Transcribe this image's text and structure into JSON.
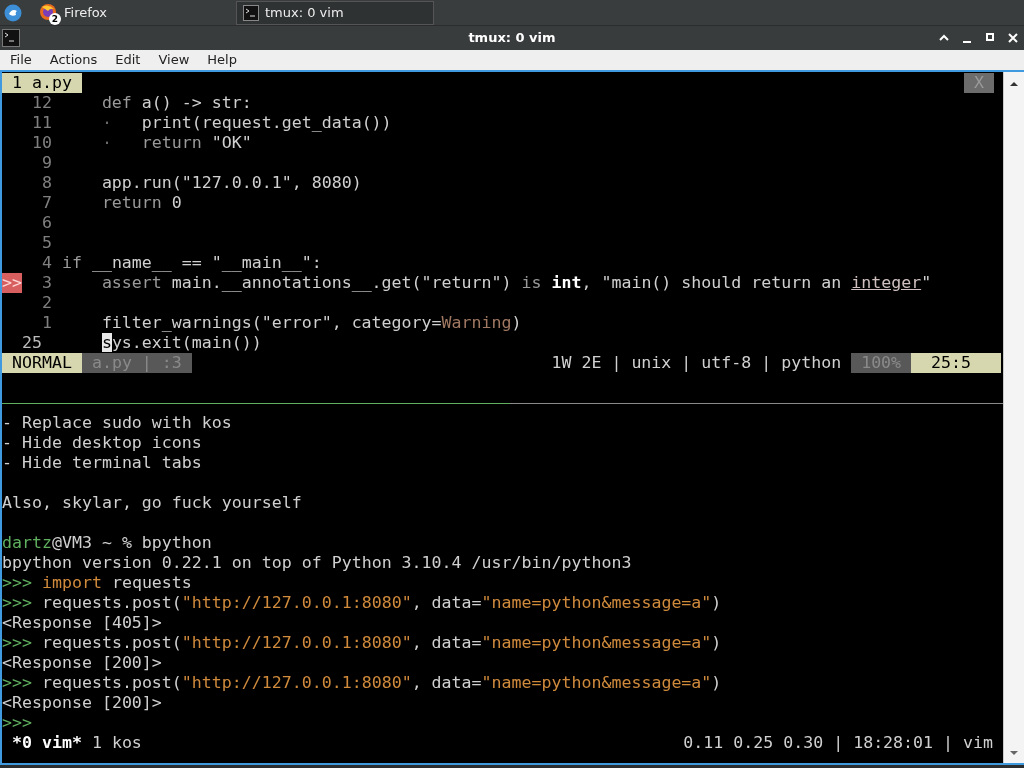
{
  "taskbar": {
    "tasks": [
      {
        "kind": "browser",
        "label": "Firefox",
        "badge": "2",
        "selected": false
      },
      {
        "kind": "terminal",
        "label": "tmux: 0 vim",
        "selected": true
      }
    ]
  },
  "window": {
    "title": "tmux: 0 vim"
  },
  "menu": [
    "File",
    "Actions",
    "Edit",
    "View",
    "Help"
  ],
  "vim": {
    "tab": "1 a.py",
    "close": "X",
    "lines": [
      {
        "number": "12",
        "current": false,
        "segments": [
          {
            "text": "    def",
            "kind": "keyword"
          },
          {
            "text": " a() -> str:",
            "kind": "normal"
          }
        ]
      },
      {
        "number": "11",
        "current": false,
        "segments": [
          {
            "text": "    ·",
            "kind": "dim"
          },
          {
            "text": "   print(request.get_data())",
            "kind": "normal"
          }
        ]
      },
      {
        "number": "10",
        "current": false,
        "segments": [
          {
            "text": "    ·",
            "kind": "dim"
          },
          {
            "text": "   return",
            "kind": "keyword"
          },
          {
            "text": " \"OK\"",
            "kind": "normal"
          }
        ]
      },
      {
        "number": "9",
        "current": false
      },
      {
        "number": "8",
        "current": false,
        "segments": [
          {
            "text": "    app.run(\"127.0.0.1\", 8080)",
            "kind": "normal"
          }
        ]
      },
      {
        "number": "7",
        "current": false,
        "segments": [
          {
            "text": "    return",
            "kind": "keyword"
          },
          {
            "text": " 0",
            "kind": "normal"
          }
        ]
      },
      {
        "number": "6",
        "current": false
      },
      {
        "number": "5",
        "current": false
      },
      {
        "number": "4",
        "current": false,
        "segments": [
          {
            "text": "if",
            "kind": "keyword"
          },
          {
            "text": " __name__ == \"__main__\":",
            "kind": "normal"
          }
        ]
      },
      {
        "number": "3",
        "current": false,
        "sign": ">>",
        "segments": [
          {
            "text": "    assert",
            "kind": "keyword"
          },
          {
            "text": " main.__annotations__.get(\"return\") ",
            "kind": "normal"
          },
          {
            "text": "is",
            "kind": "keyword"
          },
          {
            "text": " int",
            "kind": "bold"
          },
          {
            "text": ", \"main() should return an ",
            "kind": "normal"
          },
          {
            "text": "integer",
            "kind": "spell"
          },
          {
            "text": "\"",
            "kind": "normal"
          }
        ]
      },
      {
        "number": "2",
        "current": false
      },
      {
        "number": "1",
        "current": false,
        "segments": [
          {
            "text": "    filter_warnings(\"error\", category=",
            "kind": "normal"
          },
          {
            "text": "Warning",
            "kind": "builtin"
          },
          {
            "text": ")",
            "kind": "normal"
          }
        ]
      },
      {
        "number": "25",
        "current": true,
        "segments": [
          {
            "text": "    s",
            "kind": "cursor"
          },
          {
            "text": "ys.exit(main())",
            "kind": "normal"
          }
        ]
      }
    ],
    "statusline": {
      "mode": "NORMAL",
      "file": "a.py | :3",
      "info": "1W 2E | unix | utf-8 | python",
      "percent": "100%",
      "position": "25:5"
    }
  },
  "shell": {
    "blocks": [
      [
        [
          {
            "text": "- Replace sudo with kos",
            "kind": "normal"
          }
        ],
        [
          {
            "text": "- Hide desktop icons",
            "kind": "normal"
          }
        ],
        [
          {
            "text": "- Hide terminal tabs",
            "kind": "normal"
          }
        ]
      ],
      [
        [
          {
            "text": "Also, skylar, go fuck yourself",
            "kind": "normal"
          }
        ]
      ],
      [
        [
          {
            "text": "dartz",
            "kind": "green"
          },
          {
            "text": "@VM3 ~ % bpython",
            "kind": "normal"
          }
        ],
        [
          {
            "text": "bpython version 0.22.1 on top of Python 3.10.4 /usr/bin/python3",
            "kind": "normal"
          }
        ],
        [
          {
            "text": ">>>",
            "kind": "green"
          },
          {
            "text": " import",
            "kind": "orange"
          },
          {
            "text": " requests",
            "kind": "normal"
          }
        ],
        [
          {
            "text": ">>>",
            "kind": "green"
          },
          {
            "text": " requests.post(",
            "kind": "normal"
          },
          {
            "text": "\"http://127.0.0.1:8080\"",
            "kind": "orange"
          },
          {
            "text": ", data=",
            "kind": "normal"
          },
          {
            "text": "\"name=python&message=a\"",
            "kind": "orange"
          },
          {
            "text": ")",
            "kind": "normal"
          }
        ],
        [
          {
            "text": "<Response [405]>",
            "kind": "normal"
          }
        ],
        [
          {
            "text": ">>>",
            "kind": "green"
          },
          {
            "text": " requests.post(",
            "kind": "normal"
          },
          {
            "text": "\"http://127.0.0.1:8080\"",
            "kind": "orange"
          },
          {
            "text": ", data=",
            "kind": "normal"
          },
          {
            "text": "\"name=python&message=a\"",
            "kind": "orange"
          },
          {
            "text": ")",
            "kind": "normal"
          }
        ],
        [
          {
            "text": "<Response [200]>",
            "kind": "normal"
          }
        ],
        [
          {
            "text": ">>>",
            "kind": "green"
          },
          {
            "text": " requests.post(",
            "kind": "normal"
          },
          {
            "text": "\"http://127.0.0.1:8080\"",
            "kind": "orange"
          },
          {
            "text": ", data=",
            "kind": "normal"
          },
          {
            "text": "\"name=python&message=a\"",
            "kind": "orange"
          },
          {
            "text": ")",
            "kind": "normal"
          }
        ],
        [
          {
            "text": "<Response [200]>",
            "kind": "normal"
          }
        ],
        [
          {
            "text": ">>>",
            "kind": "green"
          }
        ]
      ]
    ]
  },
  "tmux": {
    "windows": [
      {
        "label": "*0 vim*",
        "selected": true
      },
      {
        "label": "1 kos",
        "selected": false
      }
    ],
    "right": "0.11 0.25 0.30 | 18:28:01 | vim"
  }
}
